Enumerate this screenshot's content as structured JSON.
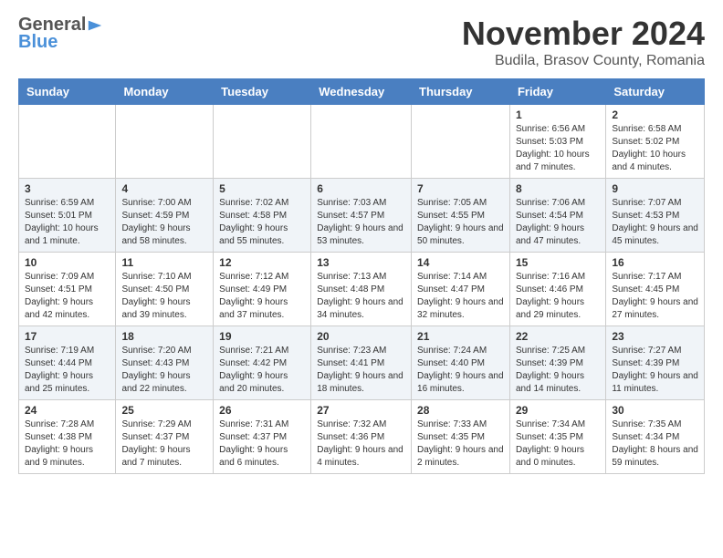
{
  "header": {
    "logo_general": "General",
    "logo_blue": "Blue",
    "main_title": "November 2024",
    "subtitle": "Budila, Brasov County, Romania"
  },
  "calendar": {
    "days_of_week": [
      "Sunday",
      "Monday",
      "Tuesday",
      "Wednesday",
      "Thursday",
      "Friday",
      "Saturday"
    ],
    "weeks": [
      [
        {
          "day": "",
          "info": ""
        },
        {
          "day": "",
          "info": ""
        },
        {
          "day": "",
          "info": ""
        },
        {
          "day": "",
          "info": ""
        },
        {
          "day": "",
          "info": ""
        },
        {
          "day": "1",
          "info": "Sunrise: 6:56 AM\nSunset: 5:03 PM\nDaylight: 10 hours and 7 minutes."
        },
        {
          "day": "2",
          "info": "Sunrise: 6:58 AM\nSunset: 5:02 PM\nDaylight: 10 hours and 4 minutes."
        }
      ],
      [
        {
          "day": "3",
          "info": "Sunrise: 6:59 AM\nSunset: 5:01 PM\nDaylight: 10 hours and 1 minute."
        },
        {
          "day": "4",
          "info": "Sunrise: 7:00 AM\nSunset: 4:59 PM\nDaylight: 9 hours and 58 minutes."
        },
        {
          "day": "5",
          "info": "Sunrise: 7:02 AM\nSunset: 4:58 PM\nDaylight: 9 hours and 55 minutes."
        },
        {
          "day": "6",
          "info": "Sunrise: 7:03 AM\nSunset: 4:57 PM\nDaylight: 9 hours and 53 minutes."
        },
        {
          "day": "7",
          "info": "Sunrise: 7:05 AM\nSunset: 4:55 PM\nDaylight: 9 hours and 50 minutes."
        },
        {
          "day": "8",
          "info": "Sunrise: 7:06 AM\nSunset: 4:54 PM\nDaylight: 9 hours and 47 minutes."
        },
        {
          "day": "9",
          "info": "Sunrise: 7:07 AM\nSunset: 4:53 PM\nDaylight: 9 hours and 45 minutes."
        }
      ],
      [
        {
          "day": "10",
          "info": "Sunrise: 7:09 AM\nSunset: 4:51 PM\nDaylight: 9 hours and 42 minutes."
        },
        {
          "day": "11",
          "info": "Sunrise: 7:10 AM\nSunset: 4:50 PM\nDaylight: 9 hours and 39 minutes."
        },
        {
          "day": "12",
          "info": "Sunrise: 7:12 AM\nSunset: 4:49 PM\nDaylight: 9 hours and 37 minutes."
        },
        {
          "day": "13",
          "info": "Sunrise: 7:13 AM\nSunset: 4:48 PM\nDaylight: 9 hours and 34 minutes."
        },
        {
          "day": "14",
          "info": "Sunrise: 7:14 AM\nSunset: 4:47 PM\nDaylight: 9 hours and 32 minutes."
        },
        {
          "day": "15",
          "info": "Sunrise: 7:16 AM\nSunset: 4:46 PM\nDaylight: 9 hours and 29 minutes."
        },
        {
          "day": "16",
          "info": "Sunrise: 7:17 AM\nSunset: 4:45 PM\nDaylight: 9 hours and 27 minutes."
        }
      ],
      [
        {
          "day": "17",
          "info": "Sunrise: 7:19 AM\nSunset: 4:44 PM\nDaylight: 9 hours and 25 minutes."
        },
        {
          "day": "18",
          "info": "Sunrise: 7:20 AM\nSunset: 4:43 PM\nDaylight: 9 hours and 22 minutes."
        },
        {
          "day": "19",
          "info": "Sunrise: 7:21 AM\nSunset: 4:42 PM\nDaylight: 9 hours and 20 minutes."
        },
        {
          "day": "20",
          "info": "Sunrise: 7:23 AM\nSunset: 4:41 PM\nDaylight: 9 hours and 18 minutes."
        },
        {
          "day": "21",
          "info": "Sunrise: 7:24 AM\nSunset: 4:40 PM\nDaylight: 9 hours and 16 minutes."
        },
        {
          "day": "22",
          "info": "Sunrise: 7:25 AM\nSunset: 4:39 PM\nDaylight: 9 hours and 14 minutes."
        },
        {
          "day": "23",
          "info": "Sunrise: 7:27 AM\nSunset: 4:39 PM\nDaylight: 9 hours and 11 minutes."
        }
      ],
      [
        {
          "day": "24",
          "info": "Sunrise: 7:28 AM\nSunset: 4:38 PM\nDaylight: 9 hours and 9 minutes."
        },
        {
          "day": "25",
          "info": "Sunrise: 7:29 AM\nSunset: 4:37 PM\nDaylight: 9 hours and 7 minutes."
        },
        {
          "day": "26",
          "info": "Sunrise: 7:31 AM\nSunset: 4:37 PM\nDaylight: 9 hours and 6 minutes."
        },
        {
          "day": "27",
          "info": "Sunrise: 7:32 AM\nSunset: 4:36 PM\nDaylight: 9 hours and 4 minutes."
        },
        {
          "day": "28",
          "info": "Sunrise: 7:33 AM\nSunset: 4:35 PM\nDaylight: 9 hours and 2 minutes."
        },
        {
          "day": "29",
          "info": "Sunrise: 7:34 AM\nSunset: 4:35 PM\nDaylight: 9 hours and 0 minutes."
        },
        {
          "day": "30",
          "info": "Sunrise: 7:35 AM\nSunset: 4:34 PM\nDaylight: 8 hours and 59 minutes."
        }
      ]
    ]
  }
}
